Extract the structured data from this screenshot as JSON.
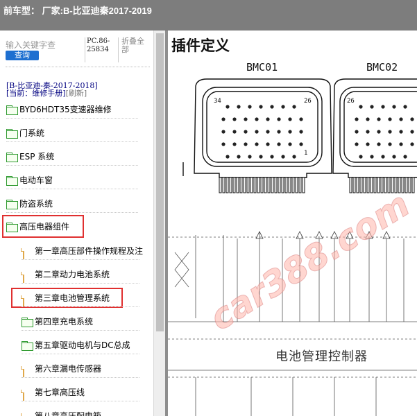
{
  "title_bar": {
    "text": "前车型： 厂家:B-比亚迪秦2017-2019"
  },
  "left_panel": {
    "search_placeholder": "输入关键字查",
    "search_button": "查询",
    "code_line1": "PC.86-",
    "code_line2": "25834",
    "fold_all": "折叠全部",
    "breadcrumb_path": "[B-比亚迪-秦-2017-2018]",
    "current_label": "[当前：维修手册]",
    "refresh_label": "[刷新]",
    "tree": [
      {
        "label": "BYD6HDT35变速器维修",
        "type": "folder"
      },
      {
        "label": "门系统",
        "type": "folder"
      },
      {
        "label": "ESP 系统",
        "type": "folder"
      },
      {
        "label": "电动车窗",
        "type": "folder"
      },
      {
        "label": "防盗系统",
        "type": "folder"
      },
      {
        "label": "高压电器组件",
        "type": "folder-open"
      },
      {
        "label": "第一章高压部件操作规程及注",
        "type": "page"
      },
      {
        "label": "第二章动力电池系统",
        "type": "page"
      },
      {
        "label": "第三章电池管理系统",
        "type": "page"
      },
      {
        "label": "第四章充电系统",
        "type": "folder"
      },
      {
        "label": "第五章驱动电机与DC总成",
        "type": "folder"
      },
      {
        "label": "第六章漏电传感器",
        "type": "page"
      },
      {
        "label": "第七章高压线",
        "type": "page"
      },
      {
        "label": "第八章高压配电箱",
        "type": "page"
      }
    ]
  },
  "document": {
    "heading": "插件定义",
    "connector_left": "BMC01",
    "connector_right": "BMC02",
    "pin_labels": {
      "p34": "34",
      "p26a": "26",
      "p26b": "26",
      "p1": "1"
    },
    "controller_label": "电池管理控制器",
    "watermark": "car388.com"
  },
  "colors": {
    "title_bg": "#7d7d7d",
    "link_blue": "#000080",
    "highlight_red": "#e03030",
    "folder_green": "#2e9a2e"
  }
}
